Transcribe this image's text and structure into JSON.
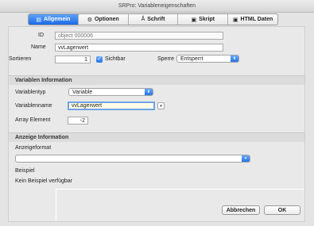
{
  "window": {
    "title": "SRPro: Variableneigenschaften"
  },
  "tabs": [
    {
      "label": "Allgemein",
      "icon": "form-icon",
      "glyph": "▤"
    },
    {
      "label": "Optionen",
      "icon": "gears-icon",
      "glyph": "⚙"
    },
    {
      "label": "Schrift",
      "icon": "font-icon",
      "glyph": "Å"
    },
    {
      "label": "Skript",
      "icon": "script-icon",
      "glyph": "▣"
    },
    {
      "label": "HTML Daten",
      "icon": "html-icon",
      "glyph": "▣"
    }
  ],
  "general": {
    "id_label": "ID",
    "id_value": "object 000006",
    "name_label": "Name",
    "name_value": "vvLagerwert",
    "sort_label": "Sortieren",
    "sort_value": "1",
    "visible_label": "Sichtbar",
    "visible_checked": true,
    "lock_label": "Sperre",
    "lock_value": "Entsperrt"
  },
  "variable_info": {
    "heading": "Variablen Information",
    "type_label": "Variablentyp",
    "type_value": "Variable",
    "varname_label": "Variablenname",
    "varname_value": "vvLagerwert",
    "array_label": "Array Element",
    "array_value": "-2"
  },
  "display_info": {
    "heading": "Anzeige Information",
    "format_label": "Anzeigeformat",
    "format_value": "",
    "example_label": "Beispiel",
    "example_value": "Kein Beispiel verfügbar"
  },
  "buttons": {
    "cancel": "Abbrechen",
    "ok": "OK"
  },
  "colors": {
    "accent": "#2773e8"
  }
}
